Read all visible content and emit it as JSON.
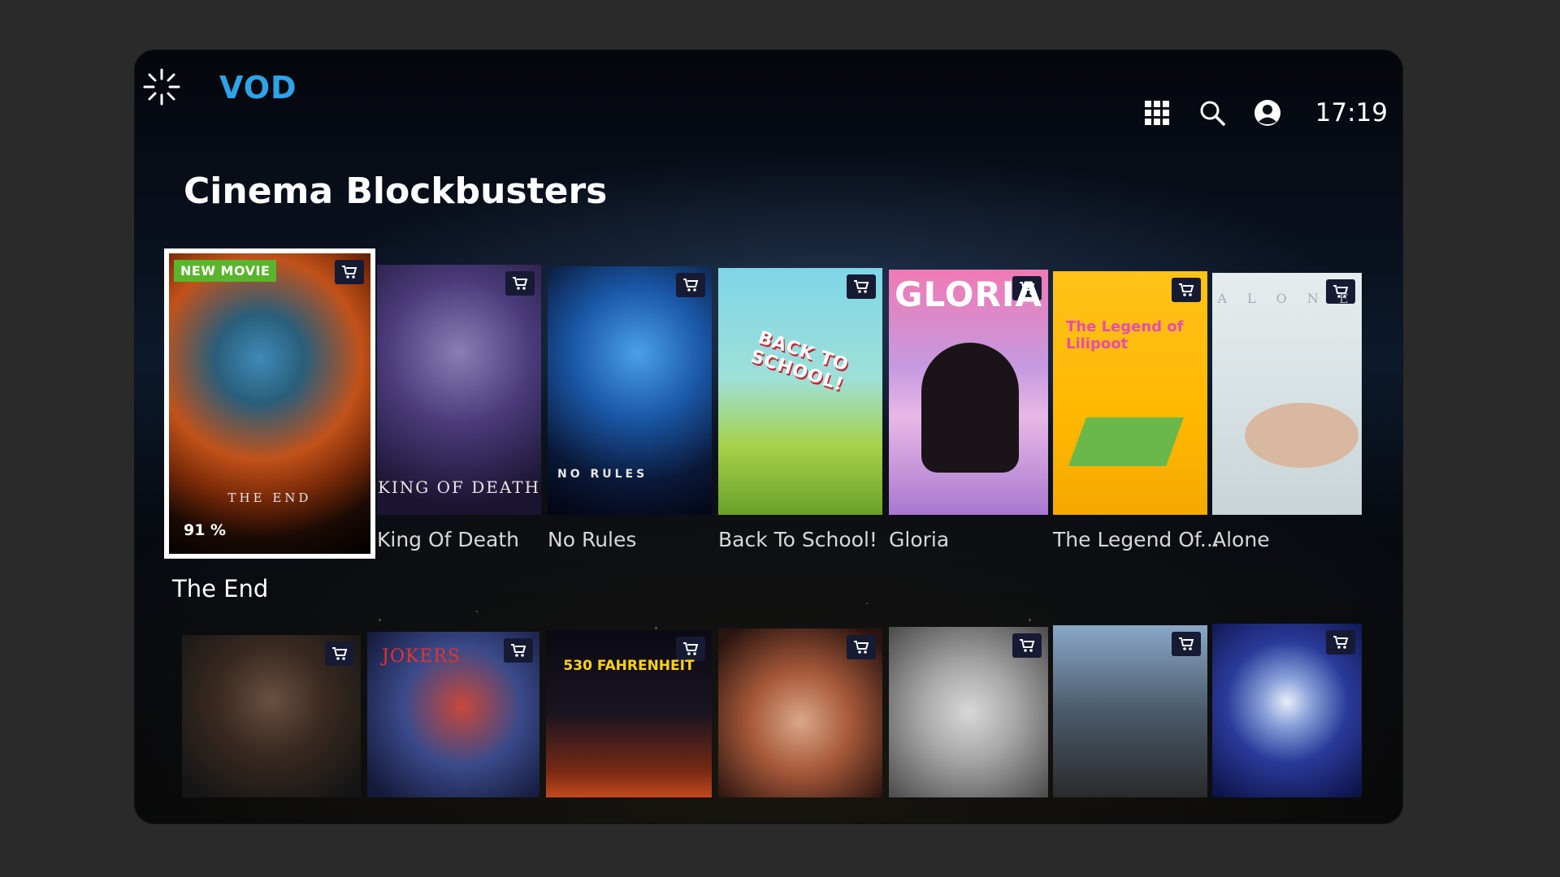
{
  "app": {
    "brand": "VOD",
    "clock": "17:19"
  },
  "icons": {
    "logo": "sparkle-logo-icon",
    "apps": "apps-grid-icon",
    "search": "search-icon",
    "profile": "user-profile-icon",
    "cart": "cart-icon"
  },
  "colors": {
    "brand": "#2da3e8",
    "badge": "#5ab52c",
    "cart_bg": "#161a33",
    "focus": "#ffffff"
  },
  "section": {
    "title": "Cinema Blockbusters"
  },
  "row1": [
    {
      "title": "The End",
      "poster_text": "THE END",
      "badge": "NEW MOVIE",
      "progress": "91 %",
      "focused": true
    },
    {
      "title": "King Of Death",
      "poster_text": "KING OF DEATH"
    },
    {
      "title": "No Rules",
      "poster_text": "NO RULES"
    },
    {
      "title": "Back To School!",
      "poster_text": "BACK TO SCHOOL!"
    },
    {
      "title": "Gloria",
      "poster_text": "GLORIA"
    },
    {
      "title": "The Legend Of...",
      "poster_text": "The Legend of Lilipoot"
    },
    {
      "title": "Alone",
      "poster_text": "A L O N E"
    }
  ],
  "row2": [
    {
      "poster_text": ""
    },
    {
      "poster_text": "JOKERS"
    },
    {
      "poster_text": "530 FAHRENHEIT"
    },
    {
      "poster_text": ""
    },
    {
      "poster_text": ""
    },
    {
      "poster_text": ""
    },
    {
      "poster_text": ""
    }
  ]
}
